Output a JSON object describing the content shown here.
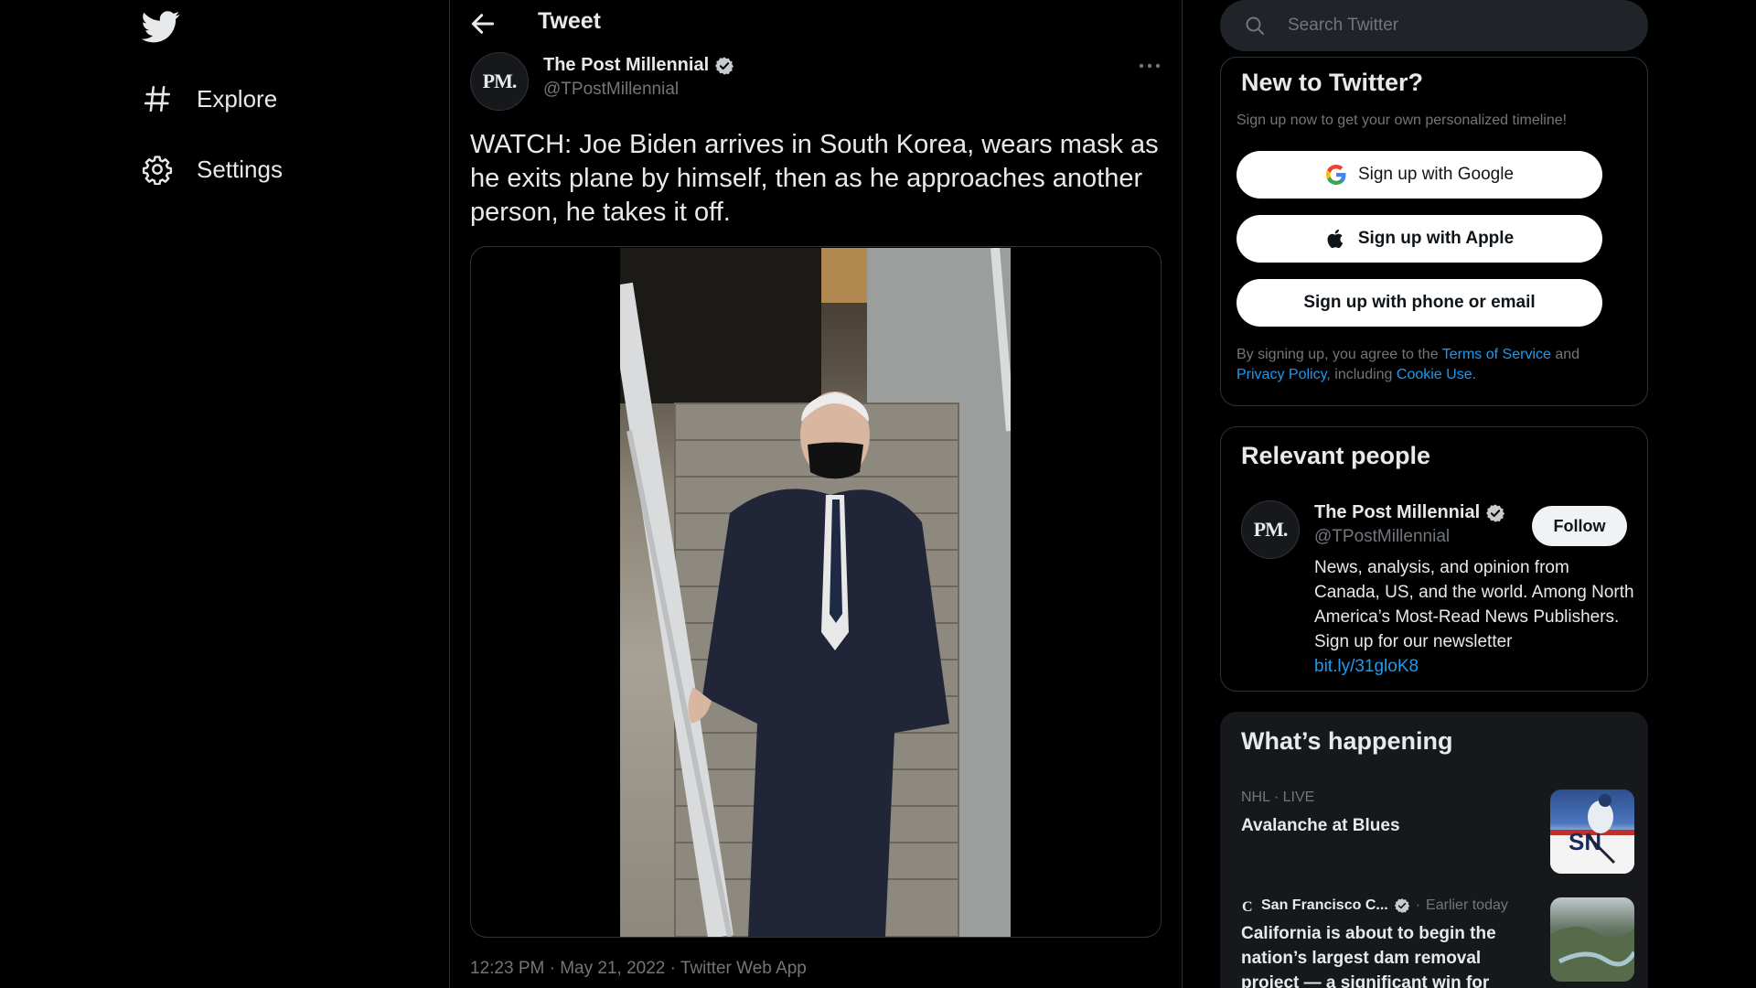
{
  "nav": {
    "explore_label": "Explore",
    "settings_label": "Settings"
  },
  "header": {
    "title": "Tweet"
  },
  "tweet": {
    "avatar_text": "PM.",
    "author_name": "The Post Millennial",
    "author_handle": "@TPostMillennial",
    "text": "WATCH: Joe Biden arrives in South Korea, wears mask as he exits plane by himself, then as he approaches another person, he takes it off.",
    "meta": "12:23 PM · May 21, 2022 · Twitter Web App"
  },
  "search": {
    "placeholder": "Search Twitter"
  },
  "signup": {
    "title": "New to Twitter?",
    "subtitle": "Sign up now to get your own personalized timeline!",
    "google_label": "Sign up with Google",
    "apple_label": "Sign up with Apple",
    "phone_label": "Sign up with phone or email",
    "legal_prefix": "By signing up, you agree to the ",
    "terms_label": "Terms of Service",
    "legal_and": " and ",
    "privacy_label": "Privacy Policy",
    "legal_including": ", including ",
    "cookie_label": "Cookie Use."
  },
  "relevant": {
    "title": "Relevant people",
    "avatar_text": "PM.",
    "name": "The Post Millennial",
    "handle": "@TPostMillennial",
    "follow_label": "Follow",
    "bio": "News, analysis, and opinion from Canada, US, and the world. Among North America’s Most-Read News Publishers. Sign up for our newsletter",
    "bio_link": "bit.ly/31gloK8"
  },
  "happening": {
    "title": "What’s happening",
    "trends": [
      {
        "meta": "NHL · LIVE",
        "title": "Avalanche at Blues"
      },
      {
        "source": "San Francisco C...",
        "time": "Earlier today",
        "title": "California is about to begin the nation’s largest dam removal project — a significant win for"
      }
    ]
  },
  "colors": {
    "background": "#000000",
    "accent": "#1d9bf0",
    "muted": "#71767b",
    "text": "#e7e9ea"
  }
}
